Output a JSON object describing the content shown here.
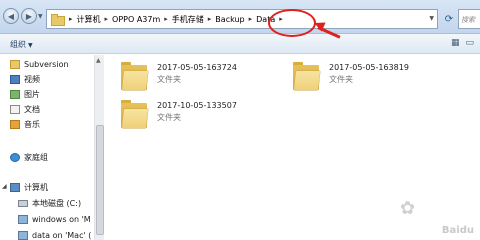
{
  "address_bar": {
    "crumbs": [
      "计算机",
      "OPPO A37m",
      "手机存储",
      "Backup",
      "Data"
    ],
    "search_placeholder": "搜索"
  },
  "command_bar": {
    "organize_label": "组织"
  },
  "nav_pane": {
    "items": [
      {
        "label": "Subversion",
        "icon": "folder-icon"
      },
      {
        "label": "视频",
        "icon": "video-icon"
      },
      {
        "label": "图片",
        "icon": "picture-icon"
      },
      {
        "label": "文档",
        "icon": "document-icon"
      },
      {
        "label": "音乐",
        "icon": "music-icon"
      },
      {
        "label": "家庭组",
        "icon": "homegroup-icon"
      },
      {
        "label": "计算机",
        "icon": "computer-icon"
      },
      {
        "label": "本地磁盘 (C:)",
        "icon": "disk-icon"
      },
      {
        "label": "windows on 'M",
        "icon": "network-drive-icon"
      },
      {
        "label": "data on 'Mac' (",
        "icon": "network-drive-icon"
      }
    ]
  },
  "files": [
    {
      "name": "2017-05-05-163724",
      "type": "文件夹"
    },
    {
      "name": "2017-05-05-163819",
      "type": "文件夹"
    },
    {
      "name": "2017-10-05-133507",
      "type": "文件夹"
    }
  ],
  "annotation": {
    "color": "#e0201c"
  },
  "watermark": {
    "text": "Baidu"
  }
}
